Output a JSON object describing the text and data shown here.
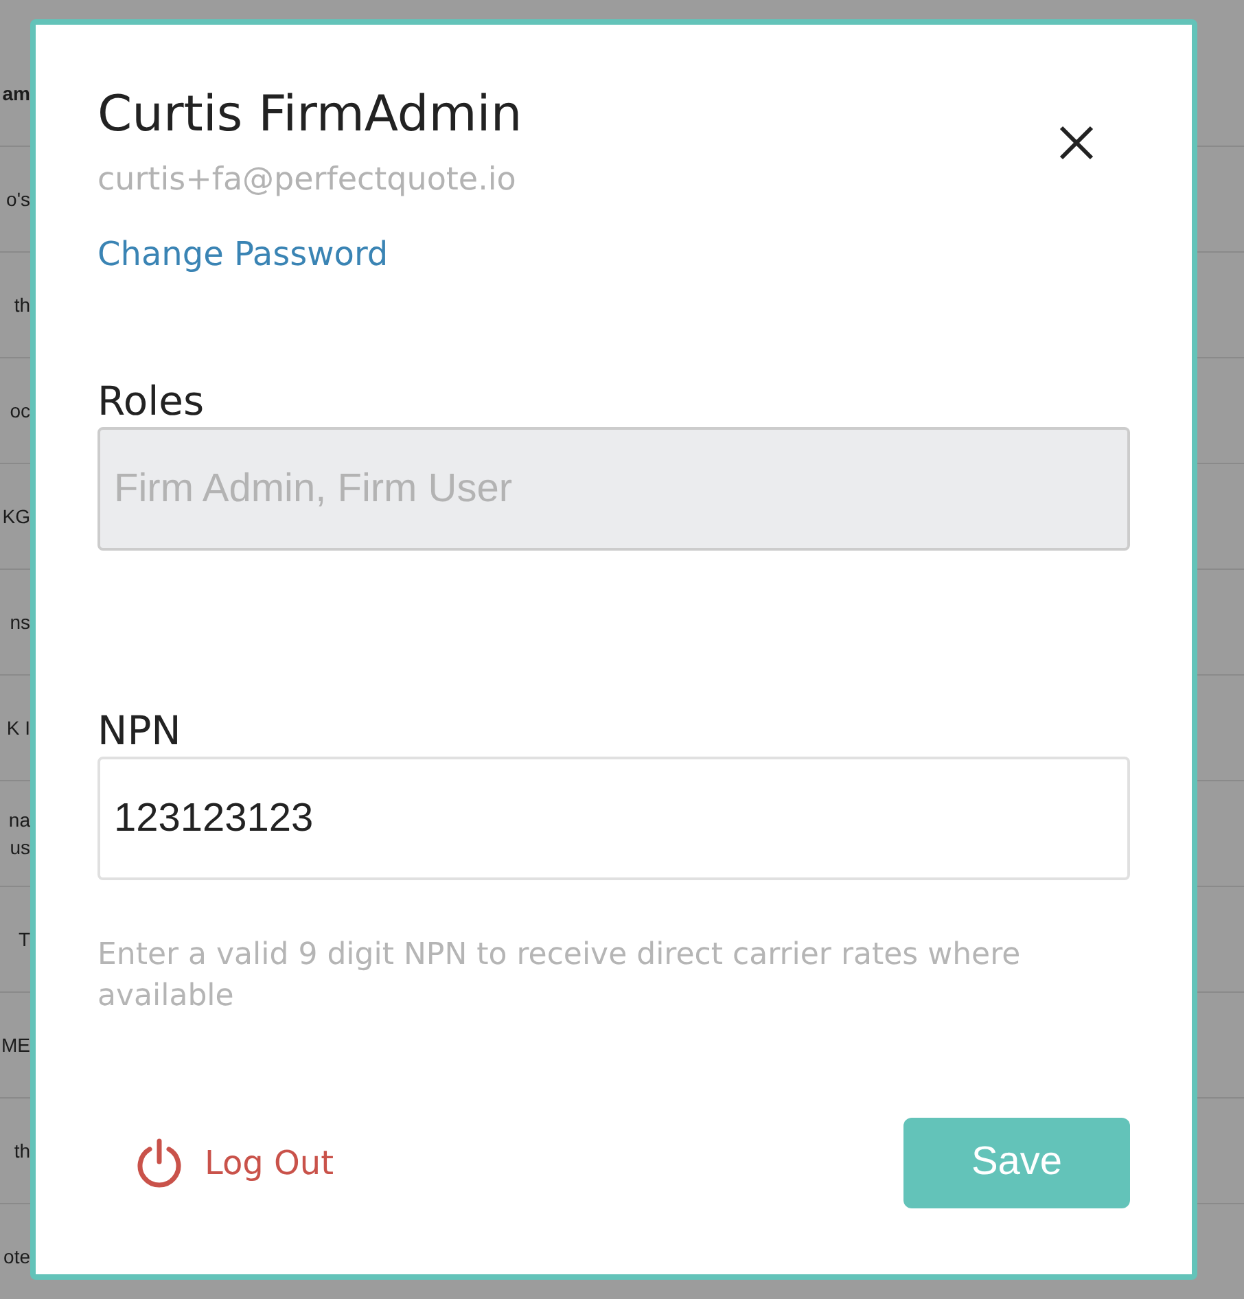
{
  "background_table": {
    "rows": [
      {
        "kind": "header",
        "lines": [
          "am"
        ]
      },
      {
        "kind": "cell",
        "lines": [
          "o's"
        ]
      },
      {
        "kind": "cell",
        "lines": [
          "th"
        ]
      },
      {
        "kind": "cell",
        "lines": [
          "oc"
        ]
      },
      {
        "kind": "cell",
        "lines": [
          "KG"
        ]
      },
      {
        "kind": "cell",
        "lines": [
          "ns"
        ]
      },
      {
        "kind": "cell",
        "lines": [
          "K I"
        ]
      },
      {
        "kind": "cell",
        "lines": [
          "na",
          "us"
        ]
      },
      {
        "kind": "cell",
        "lines": [
          "T"
        ]
      },
      {
        "kind": "cell",
        "lines": [
          "ME"
        ]
      },
      {
        "kind": "cell",
        "lines": [
          "th"
        ]
      },
      {
        "kind": "cell",
        "lines": [
          "ote"
        ]
      }
    ]
  },
  "dialog": {
    "title": "Curtis FirmAdmin",
    "email": "curtis+fa@perfectquote.io",
    "change_password_link": "Change Password",
    "fields": [
      {
        "label": "Roles",
        "value": "Firm Admin, Firm User",
        "disabled": true
      },
      {
        "label": "NPN",
        "value": "123123123",
        "disabled": false,
        "help": "Enter a valid 9 digit NPN to receive direct carrier rates where available"
      }
    ],
    "logout_button": "Log Out",
    "save_button": "Save"
  }
}
